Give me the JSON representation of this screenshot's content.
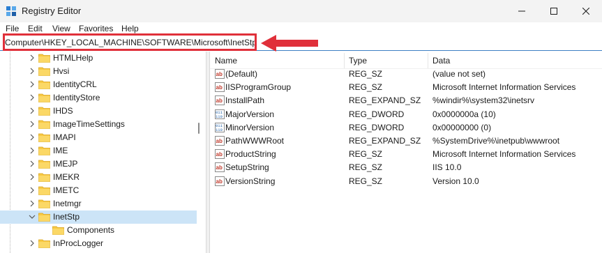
{
  "window": {
    "title": "Registry Editor",
    "icon": "registry-editor-icon"
  },
  "menu": [
    "File",
    "Edit",
    "View",
    "Favorites",
    "Help"
  ],
  "address": {
    "path": "Computer\\HKEY_LOCAL_MACHINE\\SOFTWARE\\Microsoft\\InetStp",
    "highlight_color": "#e0303a"
  },
  "tree": [
    {
      "label": "HTMLHelp",
      "expandable": true,
      "expanded": false,
      "selected": false
    },
    {
      "label": "Hvsi",
      "expandable": true,
      "expanded": false,
      "selected": false
    },
    {
      "label": "IdentityCRL",
      "expandable": true,
      "expanded": false,
      "selected": false
    },
    {
      "label": "IdentityStore",
      "expandable": true,
      "expanded": false,
      "selected": false
    },
    {
      "label": "IHDS",
      "expandable": true,
      "expanded": false,
      "selected": false
    },
    {
      "label": "ImageTimeSettings",
      "expandable": true,
      "expanded": false,
      "selected": false
    },
    {
      "label": "IMAPI",
      "expandable": true,
      "expanded": false,
      "selected": false
    },
    {
      "label": "IME",
      "expandable": true,
      "expanded": false,
      "selected": false
    },
    {
      "label": "IMEJP",
      "expandable": true,
      "expanded": false,
      "selected": false
    },
    {
      "label": "IMEKR",
      "expandable": true,
      "expanded": false,
      "selected": false
    },
    {
      "label": "IMETC",
      "expandable": true,
      "expanded": false,
      "selected": false
    },
    {
      "label": "Inetmgr",
      "expandable": true,
      "expanded": false,
      "selected": false
    },
    {
      "label": "InetStp",
      "expandable": true,
      "expanded": true,
      "selected": true
    },
    {
      "label": "Components",
      "expandable": false,
      "expanded": false,
      "selected": false,
      "child": true
    },
    {
      "label": "InProcLogger",
      "expandable": true,
      "expanded": false,
      "selected": false
    }
  ],
  "columns": {
    "name": "Name",
    "type": "Type",
    "data": "Data"
  },
  "values": [
    {
      "icon": "string-value-icon",
      "name": "(Default)",
      "type": "REG_SZ",
      "data": "(value not set)"
    },
    {
      "icon": "string-value-icon",
      "name": "IISProgramGroup",
      "type": "REG_SZ",
      "data": "Microsoft Internet Information Services"
    },
    {
      "icon": "string-value-icon",
      "name": "InstallPath",
      "type": "REG_EXPAND_SZ",
      "data": "%windir%\\system32\\inetsrv"
    },
    {
      "icon": "binary-value-icon",
      "name": "MajorVersion",
      "type": "REG_DWORD",
      "data": "0x0000000a (10)"
    },
    {
      "icon": "binary-value-icon",
      "name": "MinorVersion",
      "type": "REG_DWORD",
      "data": "0x00000000 (0)"
    },
    {
      "icon": "string-value-icon",
      "name": "PathWWWRoot",
      "type": "REG_EXPAND_SZ",
      "data": "%SystemDrive%\\inetpub\\wwwroot"
    },
    {
      "icon": "string-value-icon",
      "name": "ProductString",
      "type": "REG_SZ",
      "data": "Microsoft Internet Information Services"
    },
    {
      "icon": "string-value-icon",
      "name": "SetupString",
      "type": "REG_SZ",
      "data": "IIS 10.0"
    },
    {
      "icon": "string-value-icon",
      "name": "VersionString",
      "type": "REG_SZ",
      "data": "Version 10.0"
    }
  ],
  "colors": {
    "selection": "#cce4f7",
    "folder": "#f8c943",
    "address_underline": "#3e80c4"
  }
}
